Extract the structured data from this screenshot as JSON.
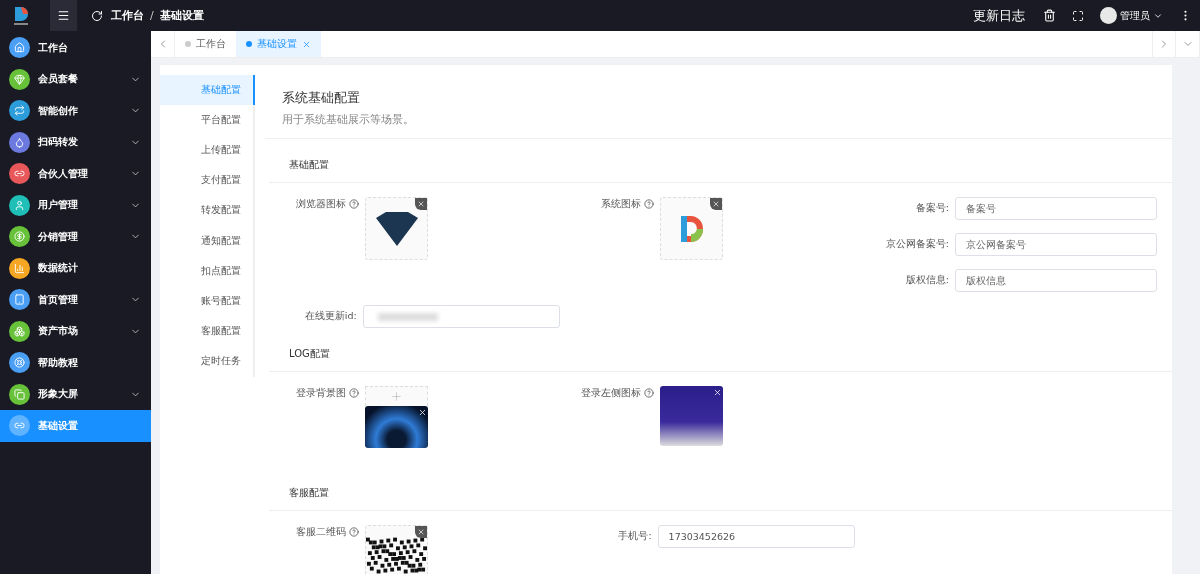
{
  "topbar": {
    "separator": "/",
    "breadcrumb": [
      "工作台",
      "基础设置"
    ],
    "changelog": "更新日志",
    "user": "管理员"
  },
  "sidebar": {
    "items": [
      {
        "label": "工作台",
        "color": "#4a9ff5",
        "expandable": false,
        "selected": false
      },
      {
        "label": "会员套餐",
        "color": "#67c23a",
        "expandable": true,
        "selected": false
      },
      {
        "label": "智能创作",
        "color": "#2d9cdb",
        "expandable": true,
        "selected": false
      },
      {
        "label": "扫码转发",
        "color": "#6c7ae0",
        "expandable": true,
        "selected": false
      },
      {
        "label": "合伙人管理",
        "color": "#e8585a",
        "expandable": true,
        "selected": false
      },
      {
        "label": "用户管理",
        "color": "#1fbfb8",
        "expandable": true,
        "selected": false
      },
      {
        "label": "分销管理",
        "color": "#67c23a",
        "expandable": true,
        "selected": false
      },
      {
        "label": "数据统计",
        "color": "#f5a623",
        "expandable": false,
        "selected": false
      },
      {
        "label": "首页管理",
        "color": "#4a9ff5",
        "expandable": true,
        "selected": false
      },
      {
        "label": "资产市场",
        "color": "#67c23a",
        "expandable": true,
        "selected": false
      },
      {
        "label": "帮助教程",
        "color": "#4a9ff5",
        "expandable": false,
        "selected": false
      },
      {
        "label": "形象大屏",
        "color": "#67c23a",
        "expandable": true,
        "selected": false
      },
      {
        "label": "基础设置",
        "color": "#5fb3ff",
        "expandable": false,
        "selected": true
      }
    ]
  },
  "tabs": [
    {
      "label": "工作台",
      "selected": false,
      "closable": false
    },
    {
      "label": "基础设置",
      "selected": true,
      "closable": true
    }
  ],
  "settings_menu": [
    {
      "label": "基础配置",
      "selected": true
    },
    {
      "label": "平台配置",
      "selected": false
    },
    {
      "label": "上传配置",
      "selected": false
    },
    {
      "label": "支付配置",
      "selected": false
    },
    {
      "label": "转发配置",
      "selected": false
    },
    {
      "label": "通知配置",
      "selected": false
    },
    {
      "label": "扣点配置",
      "selected": false
    },
    {
      "label": "账号配置",
      "selected": false
    },
    {
      "label": "客服配置",
      "selected": false
    },
    {
      "label": "定时任务",
      "selected": false
    }
  ],
  "page": {
    "title": "系统基础配置",
    "description": "用于系统基础展示等场景。"
  },
  "sections": [
    {
      "title": "基础配置",
      "columns": [
        [
          {
            "kind": "diamond",
            "label": "浏览器图标",
            "help": true
          },
          {
            "kind": "text",
            "label": "在线更新id:",
            "blurred": true
          }
        ],
        [
          {
            "kind": "lettermark",
            "label": "系统图标",
            "help": true
          }
        ],
        [
          {
            "kind": "text",
            "label": "备案号:",
            "placeholder": "备案号"
          },
          {
            "kind": "text",
            "label": "京公网备案号:",
            "placeholder": "京公网备案号"
          },
          {
            "kind": "text",
            "label": "版权信息:",
            "placeholder": "版权信息"
          }
        ]
      ]
    },
    {
      "title": "LOG配置",
      "columns": [
        [
          {
            "kind": "upload",
            "label": "登录背景图",
            "help": true
          }
        ],
        [
          {
            "kind": "poster",
            "label": "登录左侧图标",
            "help": true
          }
        ],
        []
      ]
    },
    {
      "title": "客服配置",
      "columns": [
        [
          {
            "kind": "qrcode",
            "label": "客服二维码",
            "help": true
          }
        ],
        [
          {
            "kind": "text",
            "label": "手机号:",
            "value": "17303452626"
          }
        ],
        []
      ]
    }
  ]
}
